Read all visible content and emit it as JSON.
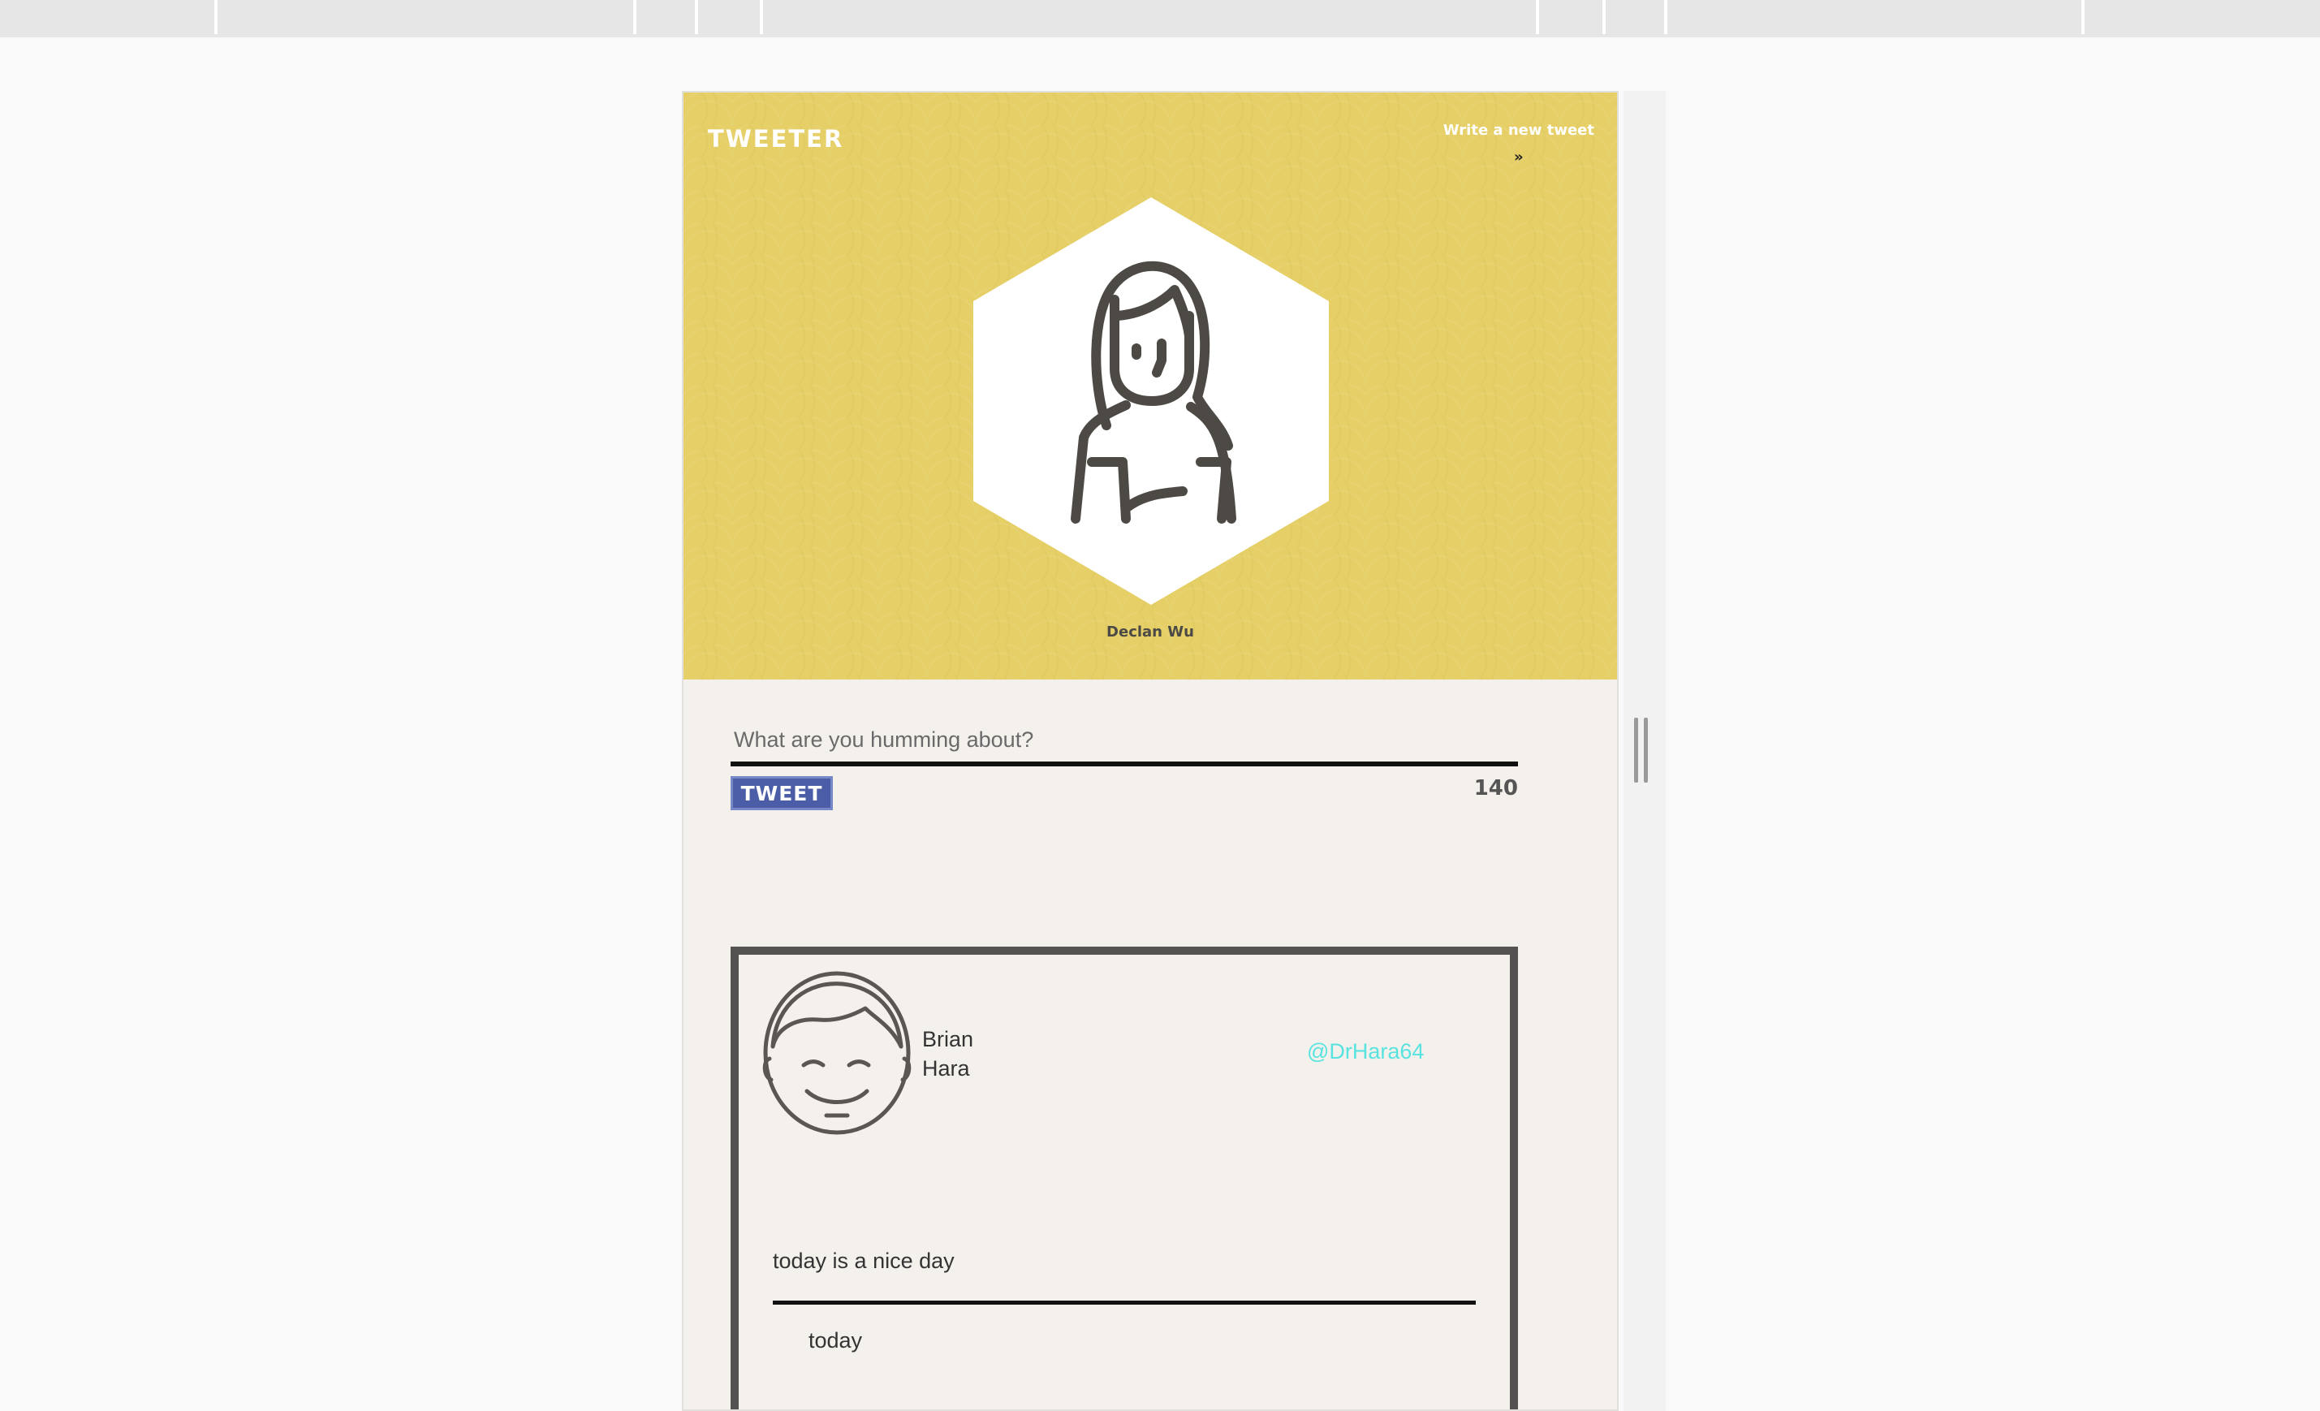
{
  "header": {
    "logo": "TWEETER",
    "compose_toggle_label": "Write a new tweet",
    "user_name": "Declan Wu",
    "bg_color": "#e5cf66"
  },
  "composer": {
    "placeholder": "What are you humming about?",
    "value": "",
    "button_label": "TWEET",
    "counter": "140",
    "button_color": "#4a5da6"
  },
  "tweets": [
    {
      "author": "Brian Hara",
      "handle": "@DrHara64",
      "body": "today is a nice day",
      "time": "today"
    }
  ],
  "icons": {
    "compose_toggle": "chevron-double-down-icon",
    "profile_avatar": "woman-avatar-icon",
    "tweet_avatar": "man-avatar-icon"
  },
  "colors": {
    "handle": "#58e3e0",
    "card_border": "#545351",
    "page_bg": "#f4f1ec"
  }
}
